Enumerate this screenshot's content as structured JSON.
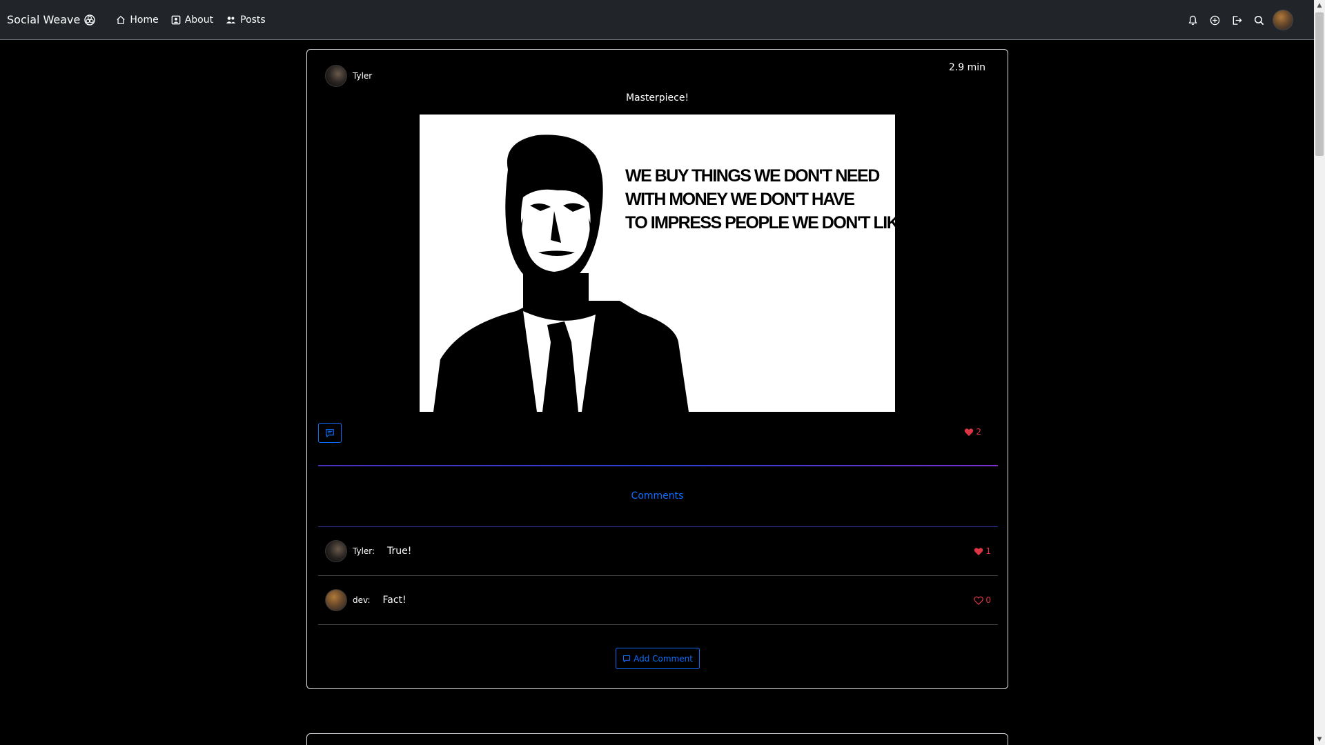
{
  "navbar": {
    "brand": "Social Weave",
    "links": [
      {
        "label": "Home",
        "icon": "home-icon"
      },
      {
        "label": "About",
        "icon": "about-icon"
      },
      {
        "label": "Posts",
        "icon": "people-icon"
      }
    ],
    "right_icons": [
      "bell-icon",
      "plus-circle-icon",
      "logout-icon",
      "search-icon"
    ]
  },
  "post": {
    "author": "Tyler",
    "time": "2.9 min",
    "caption": "Masterpiece!",
    "image_quote": [
      "WE BUY THINGS WE DON'T NEED",
      "WITH MONEY WE DON'T HAVE",
      "TO IMPRESS PEOPLE WE DON'T LIKE."
    ],
    "likes": "2"
  },
  "comments": {
    "title": "Comments",
    "items": [
      {
        "author": "Tyler:",
        "text": "True!",
        "likes": "1",
        "liked": true
      },
      {
        "author": "dev:",
        "text": "Fact!",
        "likes": "0",
        "liked": false
      }
    ],
    "add_label": "Add Comment"
  },
  "colors": {
    "navbar_bg": "#212529",
    "accent": "#0d6efd",
    "like": "#dc3545",
    "background": "#000000"
  }
}
